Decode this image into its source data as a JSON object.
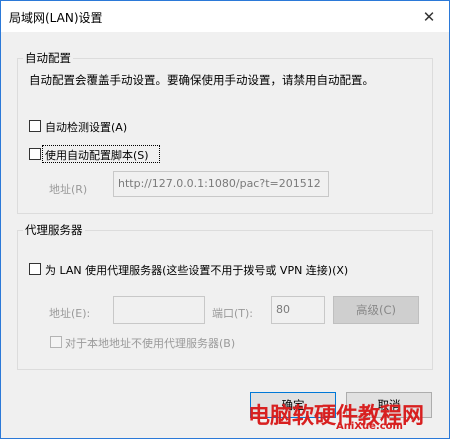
{
  "window": {
    "title": "局域网(LAN)设置",
    "close_glyph": "✕"
  },
  "auto_config": {
    "group_label": "自动配置",
    "description": "自动配置会覆盖手动设置。要确保使用手动设置，请禁用自动配置。",
    "auto_detect_label": "自动检测设置(A)",
    "use_script_label": "使用自动配置脚本(S)",
    "address_label": "地址(R)",
    "address_value": "http://127.0.0.1:1080/pac?t=201512"
  },
  "proxy": {
    "group_label": "代理服务器",
    "use_proxy_label": "为 LAN 使用代理服务器(这些设置不用于拨号或 VPN 连接)(X)",
    "address_label": "地址(E):",
    "address_value": "",
    "port_label": "端口(T):",
    "port_value": "80",
    "advanced_label": "高级(C)",
    "bypass_local_label": "对于本地地址不使用代理服务器(B)"
  },
  "buttons": {
    "ok_label": "确定",
    "cancel_label": "取消"
  },
  "watermark": {
    "text": "电脑软硬件教程网",
    "url": "AniXue.com"
  }
}
